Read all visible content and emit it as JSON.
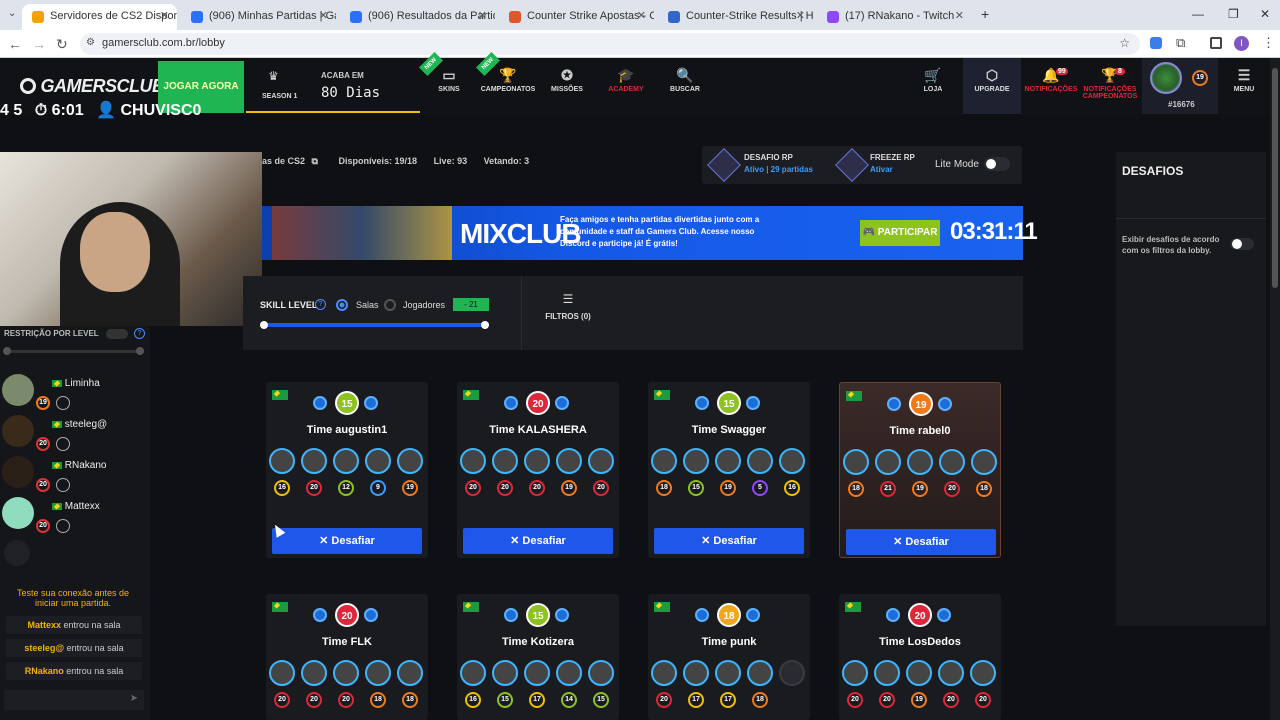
{
  "tabs": [
    {
      "label": "Servidores de CS2 Disponí",
      "color": "#f2a100"
    },
    {
      "label": "(906) Minhas Partidas | Gamers",
      "color": "#2b6fff"
    },
    {
      "label": "(906) Resultados da Partida | G",
      "color": "#2b6fff"
    },
    {
      "label": "Counter Strike Apostas - Consu",
      "color": "#e0552a"
    },
    {
      "label": "Counter-Strike Results | HLTV.c",
      "color": "#3366cc"
    },
    {
      "label": "(17) RNakano - Twitch",
      "color": "#9146ff"
    }
  ],
  "url": "gamersclub.com.br/lobby",
  "nav": {
    "logo": "GAMERSCLUB",
    "play": "JOGAR AGORA",
    "season": "SEASON 1",
    "ends_label": "ACABA EM",
    "ends_value": "80 Dias",
    "new_badge": "NEW",
    "items": [
      "SKINS",
      "CAMPEONATOS",
      "MISSÕES",
      "ACADEMY",
      "BUSCAR"
    ],
    "right_items": [
      "LOJA",
      "UPGRADE",
      "NOTIFICAÇÕES",
      "NOTIFICAÇÕES CAMPEONATOS",
      "MENU"
    ],
    "notif_badge": "99",
    "camp_badge": "8",
    "user_level": "19",
    "user_id": "#16676"
  },
  "overlay": {
    "left": "4 5",
    "timer": "6:01",
    "name": "CHUVISC0"
  },
  "sidebar": {
    "restriction": "RESTRIÇÃO POR LEVEL",
    "players": [
      {
        "name": "Liminha",
        "level": "19"
      },
      {
        "name": "steeleg@",
        "level": "20"
      },
      {
        "name": "RNakano",
        "level": "20"
      },
      {
        "name": "Mattexx",
        "level": "20"
      }
    ],
    "conn_test": "Teste sua conexão antes de iniciar uma partida.",
    "messages": [
      {
        "who": "Mattexx",
        "text": "entrou na sala"
      },
      {
        "who": "steeleg@",
        "text": "entrou na sala"
      },
      {
        "who": "RNakano",
        "text": "entrou na sala"
      }
    ]
  },
  "info": {
    "servers": "as de CS2",
    "available": "Disponíveis: 19/18",
    "live": "Live: 93",
    "veto": "Vetando: 3"
  },
  "risk": {
    "rp1_title": "DESAFIO RP",
    "rp1_sub": "Ativo | 29 partidas",
    "rp2_title": "FREEZE RP",
    "rp2_sub": "Ativar",
    "lite": "Lite Mode"
  },
  "banner": {
    "title": "MIXCLUB",
    "text": "Faça amigos e tenha partidas divertidas junto com a comunidade e staff da Gamers Club. Acesse nosso Discord e participe já! É grátis!",
    "button": "PARTICIPAR",
    "timer": "03:31:11"
  },
  "filters": {
    "skill": "SKILL LEVEL",
    "salas": "Salas",
    "jogadores": "Jogadores",
    "range": "- 21",
    "filters": "FILTROS (0)"
  },
  "cards": [
    {
      "team": "Time augustin1",
      "level": "15",
      "lcolor": "#8dc21f",
      "members": [
        "16",
        "20",
        "12",
        "9",
        "19"
      ],
      "button": "Desafiar"
    },
    {
      "team": "Time KALASHERA",
      "level": "20",
      "lcolor": "#e0263a",
      "members": [
        "20",
        "20",
        "20",
        "19",
        "20"
      ],
      "button": "Desafiar"
    },
    {
      "team": "Time Swagger",
      "level": "15",
      "lcolor": "#8dc21f",
      "members": [
        "18",
        "15",
        "19",
        "5",
        "16"
      ],
      "button": "Desafiar"
    },
    {
      "team": "Time rabel0",
      "level": "19",
      "lcolor": "#f07a1a",
      "members": [
        "18",
        "21",
        "19",
        "20",
        "18"
      ],
      "button": "Desafiar"
    },
    {
      "team": "Time FLK",
      "level": "20",
      "lcolor": "#e0263a",
      "members": [
        "20",
        "20",
        "20",
        "18",
        "18"
      ],
      "button": ""
    },
    {
      "team": "Time Kotizera",
      "level": "15",
      "lcolor": "#8dc21f",
      "members": [
        "16",
        "15",
        "17",
        "14",
        "15"
      ],
      "button": ""
    },
    {
      "team": "Time punk",
      "level": "18",
      "lcolor": "#f0a81a",
      "members": [
        "20",
        "17",
        "17",
        "18",
        ""
      ],
      "button": ""
    },
    {
      "team": "Time LosDedos",
      "level": "20",
      "lcolor": "#e0263a",
      "members": [
        "20",
        "20",
        "19",
        "20",
        "20"
      ],
      "button": ""
    }
  ],
  "right": {
    "title": "DESAFIOS",
    "filter": "Exibir desafios de acordo com os filtros da lobby."
  }
}
